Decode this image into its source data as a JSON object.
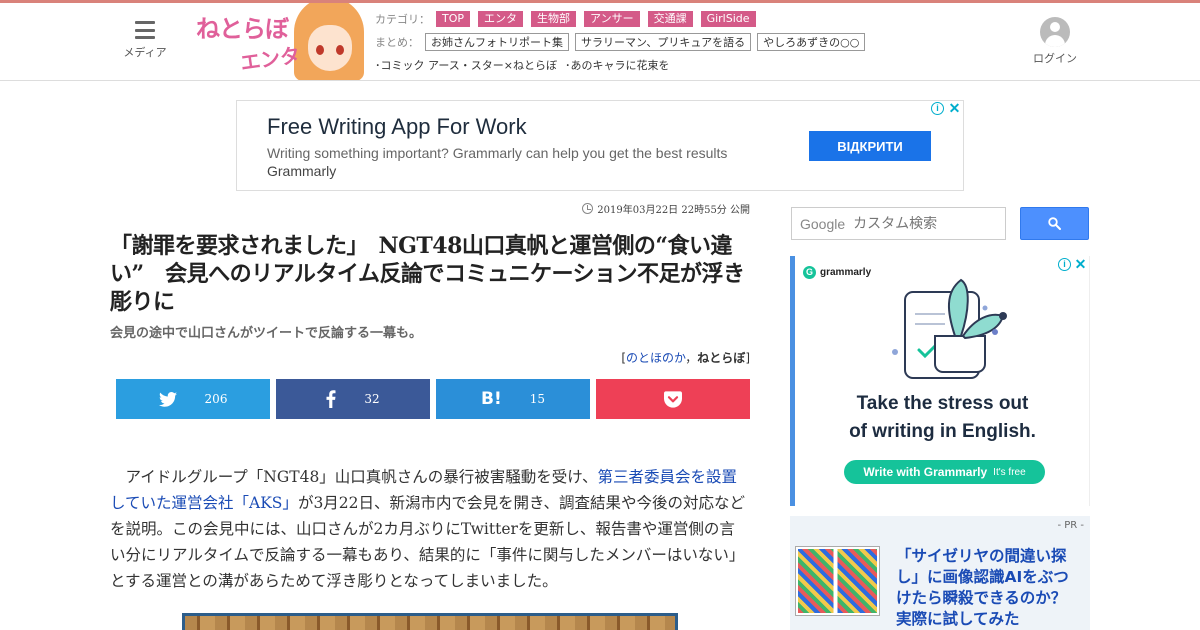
{
  "header": {
    "menu_label": "メディア",
    "logo_text": "ねとらぼ",
    "logo_sub": "エンタ",
    "category_label": "カテゴリ：",
    "categories": [
      "TOP",
      "エンタ",
      "生物部",
      "アンサー",
      "交通課",
      "GirlSide"
    ],
    "matome_label": "まとめ：",
    "matome": [
      "お姉さんフォトリポート集",
      "サラリーマン、プリキュアを語る",
      "やしろあずきの○○"
    ],
    "links": [
      "･コミック アース・スター×ねとらぼ",
      "･あのキャラに花束を"
    ],
    "login_label": "ログイン"
  },
  "top_ad": {
    "title": "Free Writing App For Work",
    "description": "Writing something important? Grammarly can help you get the best results",
    "brand": "Grammarly",
    "cta": "ВІДКРИТИ"
  },
  "article": {
    "date": "2019年03月22日 22時55分 公開",
    "title": "「謝罪を要求されました」　NGT48山口真帆と運営側の“食い違い”　会見へのリアルタイム反論でコミュニケーション不足が浮き彫りに",
    "subtitle": "会見の途中で山口さんがツイートで反論する一幕も。",
    "byline_open": "[",
    "author": "のとほのか",
    "byline_sep": "，",
    "site": "ねとらぼ",
    "byline_close": "]",
    "body_before_link": "アイドルグループ「NGT48」山口真帆さんの暴行被害騒動を受け、",
    "body_link": "第三者委員会を設置していた運営会社「AKS」",
    "body_after_link": "が3月22日、新潟市内で会見を開き、調査結果や今後の対応などを説明。この会見中には、山口さんが2カ月ぶりにTwitterを更新し、報告書や運営側の言い分にリアルタイムで反論する一幕もあり、結果的に「事件に関与したメンバーはいない」とする運営との溝があらためて浮き彫りとなってしまいました。"
  },
  "share": {
    "twitter_count": "206",
    "facebook_count": "32",
    "hatena_glyph": "B!",
    "hatena_count": "15"
  },
  "search": {
    "brand": "Google",
    "placeholder": "カスタム検索"
  },
  "side_ad": {
    "brand": "grammarly",
    "headline_1": "Take the stress out",
    "headline_2": "of writing in English.",
    "cta": "Write with Grammarly",
    "cta_note": "It's free"
  },
  "pr": {
    "label": "- PR -",
    "title": "「サイゼリヤの間違い探し」に画像認識AIをぶつけたら瞬殺できるのか？　実際に試してみた"
  },
  "colors": {
    "accent_top": "#d9827a",
    "category_bg": "#d45a88",
    "twitter": "#2b9ee0",
    "facebook": "#3b5998",
    "hatena": "#2b8fd8",
    "pocket": "#ee4056",
    "link": "#1a4bb5",
    "grammarly": "#15c39a"
  }
}
